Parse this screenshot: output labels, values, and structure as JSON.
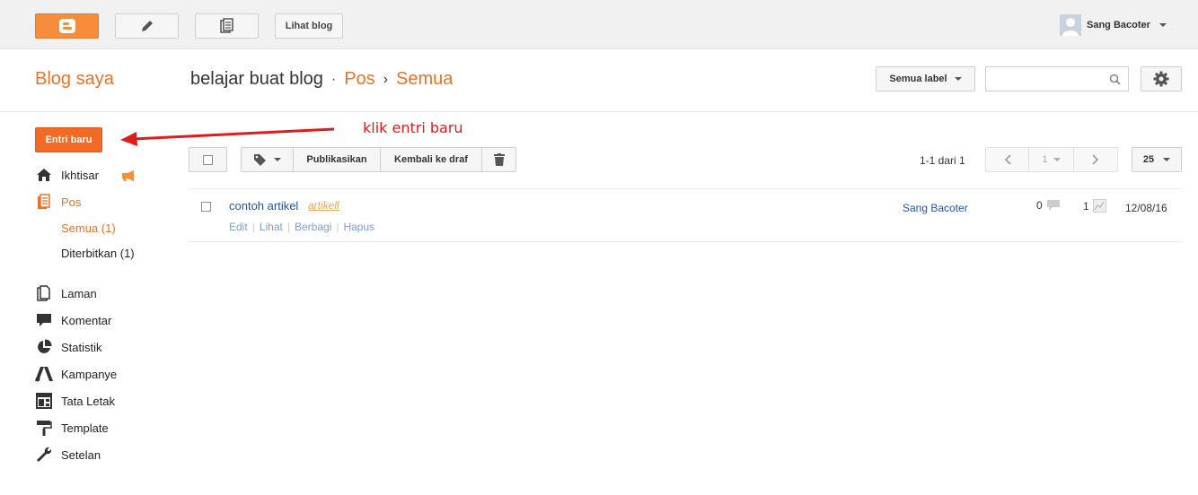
{
  "topbar": {
    "view_blog_label": "Lihat blog",
    "user_name": "Sang Bacoter"
  },
  "header": {
    "blogs_title": "Blog saya",
    "blog_name": "belajar buat blog",
    "separator": "·",
    "crumb_posts": "Pos",
    "crumb_arrow": "›",
    "crumb_all": "Semua",
    "label_filter": "Semua label",
    "search_placeholder": ""
  },
  "sidebar": {
    "new_post": "Entri baru",
    "items": [
      {
        "label": "Ikhtisar",
        "icon": "home-icon"
      },
      {
        "label": "Pos",
        "icon": "posts-icon"
      },
      {
        "label": "Laman",
        "icon": "pages-icon"
      },
      {
        "label": "Komentar",
        "icon": "comment-icon"
      },
      {
        "label": "Statistik",
        "icon": "pie-chart-icon"
      },
      {
        "label": "Kampanye",
        "icon": "adwords-icon"
      },
      {
        "label": "Tata Letak",
        "icon": "layout-icon"
      },
      {
        "label": "Template",
        "icon": "paint-roller-icon"
      },
      {
        "label": "Setelan",
        "icon": "wrench-icon"
      }
    ],
    "sub_items": [
      {
        "label": "Semua (1)"
      },
      {
        "label": "Diterbitkan (1)"
      }
    ]
  },
  "annotation": {
    "text": "klik entri baru",
    "color": "#e01b1b"
  },
  "toolbar": {
    "publish": "Publikasikan",
    "revert": "Kembali ke draf",
    "paging_text": "1-1 dari 1",
    "page_number": "1",
    "per_page": "25"
  },
  "posts": [
    {
      "title": "contoh artikel",
      "label": "artikell",
      "actions": [
        "Edit",
        "Lihat",
        "Berbagi",
        "Hapus"
      ],
      "author": "Sang Bacoter",
      "comments": "0",
      "views": "1",
      "date": "12/08/16"
    }
  ],
  "colors": {
    "accent": "#e67424",
    "button_orange": "#f26a24",
    "link_blue": "#2255aa"
  }
}
